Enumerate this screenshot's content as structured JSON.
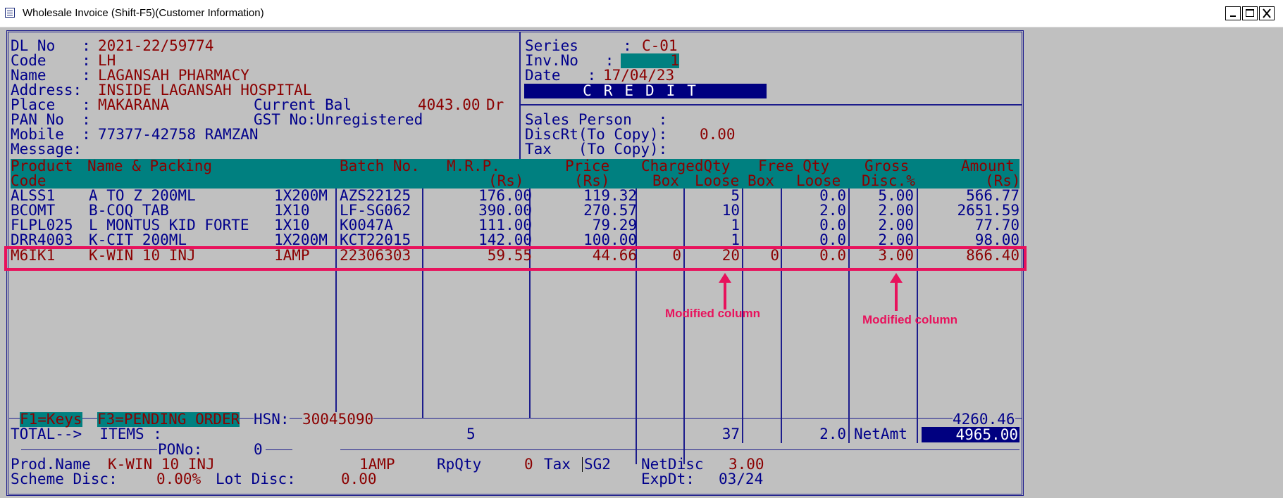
{
  "window": {
    "title": "Wholesale Invoice (Shift-F5)(Customer Information)"
  },
  "customer": {
    "dl_label": "DL No   :",
    "dl_value": "2021-22/59774",
    "code_label": "Code    :",
    "code_value": "LH",
    "name_label": "Name    :",
    "name_value": "LAGANSAH PHARMACY",
    "address_label": "Address:",
    "address_value": "INSIDE LAGANSAH HOSPITAL",
    "place_label": "Place   :",
    "place_value": "MAKARANA",
    "current_bal_label": "Current Bal",
    "current_bal_value": "4043.00",
    "current_bal_suffix": "Dr",
    "pan_label": "PAN No  :",
    "gst_label": "GST No:Unregistered",
    "mobile_label": "Mobile  :",
    "mobile_value": "77377-42758 RAMZAN",
    "message_label": "Message:"
  },
  "invoice": {
    "series_label": "Series     :",
    "series_value": "C-01",
    "invno_label": "Inv.No   :",
    "invno_value": "1",
    "date_label": "Date   :",
    "date_value": "17/04/23",
    "mode": "CREDIT",
    "sales_person_label": "Sales Person   :",
    "discrt_label": "DiscRt(To Copy):",
    "discrt_value": "0.00",
    "tax_label": "Tax   (To Copy):"
  },
  "columns": {
    "product_code_1": "Product",
    "product_code_2": "Code",
    "name_packing": "Name & Packing",
    "batch": "Batch No.",
    "mrp_1": "M.R.P.",
    "mrp_2": "(Rs)",
    "price_1": "Price",
    "price_2": "(Rs)",
    "charged_qty": "ChargedQty",
    "charged_box": "Box",
    "charged_loose": "Loose",
    "free_qty": "Free Qty",
    "free_box": "Box",
    "free_loose": "Loose",
    "gross": "Gross",
    "disc": "Disc.%",
    "amount_1": "Amount",
    "amount_2": "(Rs)"
  },
  "rows": [
    {
      "code": "ALSS1",
      "name": "A TO Z 200ML",
      "pack": "1X200M",
      "batch": "AZS22125",
      "mrp": "176.00",
      "price": "119.32",
      "cbox": "",
      "cloose": "5",
      "fbox": "",
      "floose": "0.0",
      "disc": "5.00",
      "amount": "566.77"
    },
    {
      "code": "BCOMT",
      "name": "B-COQ TAB",
      "pack": "1X10",
      "batch": "LF-SG062",
      "mrp": "390.00",
      "price": "270.57",
      "cbox": "",
      "cloose": "10",
      "fbox": "",
      "floose": "2.0",
      "disc": "2.00",
      "amount": "2651.59"
    },
    {
      "code": "FLPL025",
      "name": "L MONTUS KID FORTE",
      "pack": "1X10",
      "batch": "K0047A",
      "mrp": "111.00",
      "price": "79.29",
      "cbox": "",
      "cloose": "1",
      "fbox": "",
      "floose": "0.0",
      "disc": "2.00",
      "amount": "77.70"
    },
    {
      "code": "DRR4003",
      "name": "K-CIT 200ML",
      "pack": "1X200M",
      "batch": "KCT22015",
      "mrp": "142.00",
      "price": "100.00",
      "cbox": "",
      "cloose": "1",
      "fbox": "",
      "floose": "0.0",
      "disc": "2.00",
      "amount": "98.00"
    },
    {
      "code": "M6IK1",
      "name": "K-WIN 10 INJ",
      "pack": "1AMP",
      "batch": "22306303",
      "mrp": "59.55",
      "price": "44.66",
      "cbox": "0",
      "cloose": "20",
      "fbox": "0",
      "floose": "0.0",
      "disc": "3.00",
      "amount": "866.40"
    }
  ],
  "annotations": {
    "note1": "Modified column",
    "note2": "Modified column",
    "color": "#e8125c"
  },
  "footer": {
    "f1": "F1=Keys",
    "f3": "F3=PENDING ORDER",
    "hsn_label": "HSN:",
    "hsn_value": "30045090",
    "gross_total": "4260.46",
    "total_label": "TOTAL-->  ITEMS :",
    "items": "5",
    "qty_total": "37",
    "free_total": "2.0",
    "netamt_label": "NetAmt",
    "netamt_value": "4965.00",
    "pono_label": "PONo:",
    "pono_value": "0",
    "prodname_label": "Prod.Name",
    "prodname_value": "K-WIN 10 INJ",
    "pack": "1AMP",
    "rpqty_label": "RpQty",
    "rpqty_value": "0",
    "tax_label": "Tax",
    "tax_value": "SG2",
    "netdisc_label": "NetDisc",
    "netdisc_value": "3.00",
    "scheme_label": "Scheme Disc:",
    "scheme_value": "0.00%",
    "lot_label": "Lot Disc:",
    "lot_value": "0.00",
    "expdt_label": "ExpDt:",
    "expdt_value": "03/24"
  },
  "colors": {
    "background": "#c0c0c0",
    "frame": "#1c1c8c",
    "teal": "#008080",
    "navy": "#000080",
    "value_red": "#8b0000"
  }
}
